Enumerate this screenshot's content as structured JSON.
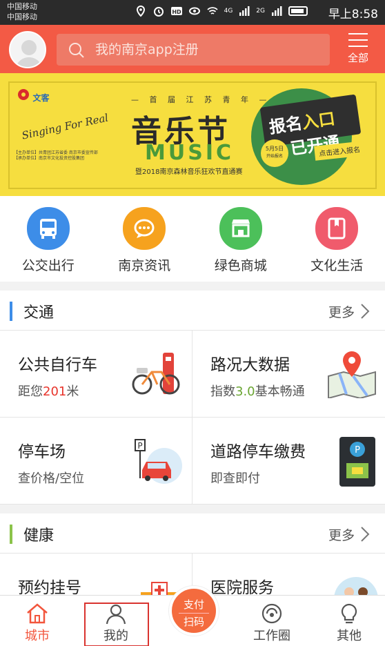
{
  "status_bar": {
    "carrier_1": "中国移动",
    "carrier_2": "中国移动",
    "network_1": "4G",
    "network_2": "2G",
    "time": "早上8:58"
  },
  "header": {
    "search_placeholder": "我的南京app注册",
    "menu_label": "全部"
  },
  "banner": {
    "series": "— 首 届 江 苏 青 年 —",
    "title": "音乐节",
    "subtitle": "MUSIC",
    "script": "Singing For Real",
    "tagline": "暨2018南京森林音乐狂欢节直通赛",
    "logo_text": "文客",
    "badge_line1": "报名",
    "badge_highlight": "入口",
    "badge_line2": "已开通",
    "date": "5月5日",
    "date_note": "开始报名",
    "cta": "点击进入报名",
    "fine_print": "【主办单位】共青团江苏省委 南京市委宣传部 【承办单位】南京市文化投资控股集团"
  },
  "quick_services": [
    {
      "label": "公交出行",
      "icon": "bus-icon",
      "color": "#3d8de8"
    },
    {
      "label": "南京资讯",
      "icon": "chat-icon",
      "color": "#f6a21e"
    },
    {
      "label": "绿色商城",
      "icon": "shop-icon",
      "color": "#4cc05a"
    },
    {
      "label": "文化生活",
      "icon": "book-icon",
      "color": "#f05b6c"
    }
  ],
  "traffic": {
    "title": "交通",
    "more": "更多",
    "accent": "#3d8de8",
    "cards": [
      {
        "title": "公共自行车",
        "sub_prefix": "距您",
        "sub_value": "201",
        "sub_suffix": "米",
        "icon": "bicycle-icon"
      },
      {
        "title": "路况大数据",
        "sub_prefix": "指数",
        "sub_value": "3.0",
        "sub_suffix": "基本畅通",
        "icon": "map-pin-icon"
      },
      {
        "title": "停车场",
        "sub": "查价格/空位",
        "icon": "parking-car-icon"
      },
      {
        "title": "道路停车缴费",
        "sub": "即查即付",
        "icon": "parking-meter-icon"
      }
    ]
  },
  "health": {
    "title": "健康",
    "more": "更多",
    "accent": "#8bc34a",
    "cards": [
      {
        "title": "预约挂号",
        "icon": "hospital-icon"
      },
      {
        "title": "医院服务",
        "icon": "doctor-icon"
      }
    ]
  },
  "bottom_nav": {
    "city": "城市",
    "mine": "我的",
    "pay_line1": "支付",
    "pay_line2": "扫码",
    "work": "工作圈",
    "other": "其他"
  }
}
